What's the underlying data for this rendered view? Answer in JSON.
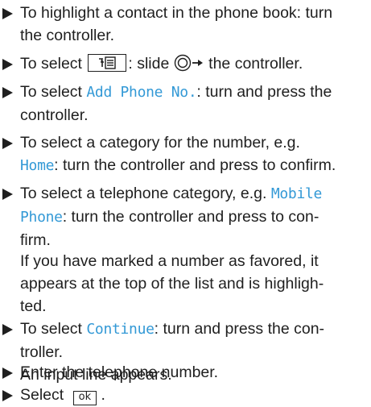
{
  "steps": {
    "s1": {
      "l1": "To highlight a contact in the phone book: turn",
      "l2": "the controller."
    },
    "s2": {
      "prefix": "To select",
      "middle": ": slide",
      "suffix": "the controller.",
      "icon": "phone-book-menu-icon"
    },
    "s3": {
      "prefix": "To select",
      "option": "Add Phone No.",
      "rest": ": turn and press the",
      "l2": "controller."
    },
    "s4": {
      "l1": "To select a category for the number, e.g.",
      "option": "Home",
      "rest": ": turn the controller and press to confirm."
    },
    "s5": {
      "prefix": "To select a telephone category, e.g.",
      "option_a": "Mobile",
      "option_b": "Phone",
      "rest": ": turn the controller and press to con-",
      "l3": "firm."
    },
    "note": {
      "l1": "If you have marked a number as favored, it",
      "l2": "appears at the top of the list and is highligh-",
      "l3": "ted."
    },
    "s6": {
      "prefix": "To select",
      "option": "Continue",
      "rest": ": turn and press the con-",
      "l2": "troller.",
      "l3": "An input line appears."
    },
    "s7": {
      "text": "Enter the telephone number."
    },
    "s8": {
      "prefix": "Select",
      "key": "ok",
      "suffix": "."
    }
  },
  "colors": {
    "option": "#3399d6",
    "text": "#1f1f1f"
  }
}
